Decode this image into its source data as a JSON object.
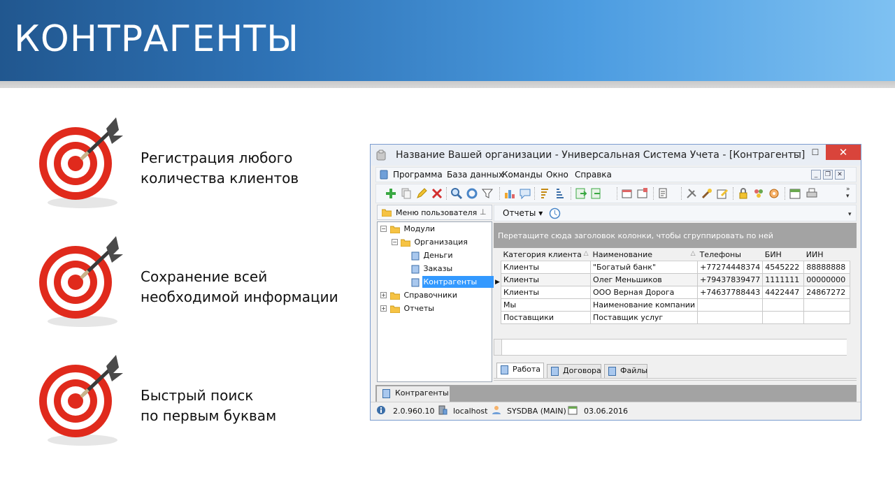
{
  "slide": {
    "title": "КОНТРАГЕНТЫ",
    "bullets": [
      {
        "line1": "Регистрация любого",
        "line2": "количества клиентов",
        "icon": "target-dart-icon"
      },
      {
        "line1": "Сохранение всей",
        "line2": "необходимой информации",
        "icon": "target-dart-icon"
      },
      {
        "line1": "Быстрый поиск",
        "line2": "по первым буквам",
        "icon": "target-dart-icon"
      }
    ],
    "colors": {
      "banner_start": "#21578f",
      "banner_end": "#7ec1f2",
      "target_red": "#e02a1c"
    }
  },
  "window": {
    "title": "Название Вашей организации - Универсальная Система Учета - [Контрагенты]",
    "controls": {
      "minimize": "—",
      "maximize": "☐",
      "close": "✕"
    },
    "menu": [
      "Программа",
      "База данных",
      "Команды",
      "Окно",
      "Справка"
    ],
    "mdi_controls": [
      "_",
      "❐",
      "✕"
    ],
    "toolbar_icons": [
      "add-icon",
      "copy-icon",
      "edit-icon",
      "delete-icon",
      "search-icon",
      "refresh-icon",
      "filter-icon",
      "chart-icon",
      "comment-icon",
      "sort-asc-icon",
      "sort-desc-icon",
      "export-icon",
      "import-icon",
      "new-window-icon",
      "new-doc-icon",
      "print-preview-icon",
      "tools-icon",
      "wand-icon",
      "edit-doc-icon",
      "lock-icon",
      "users-icon",
      "settings-icon",
      "calendar-icon",
      "printer-icon"
    ],
    "user_menu": {
      "header": "Меню пользователя",
      "tree": [
        {
          "label": "Модули",
          "level": 0,
          "expanded": true,
          "type": "folder"
        },
        {
          "label": "Организация",
          "level": 1,
          "expanded": true,
          "type": "folder"
        },
        {
          "label": "Деньги",
          "level": 2,
          "type": "doc"
        },
        {
          "label": "Заказы",
          "level": 2,
          "type": "doc"
        },
        {
          "label": "Контрагенты",
          "level": 2,
          "type": "doc",
          "selected": true
        },
        {
          "label": "Справочники",
          "level": 0,
          "expanded": false,
          "type": "folder"
        },
        {
          "label": "Отчеты",
          "level": 0,
          "expanded": false,
          "type": "folder"
        }
      ]
    },
    "reports_button": "Отчеты",
    "group_hint": "Перетащите сюда заголовок колонки, чтобы сгруппировать по ней",
    "grid": {
      "columns": [
        "Категория клиента",
        "Наименование",
        "Телефоны",
        "БИН",
        "ИИН"
      ],
      "rows": [
        [
          "Клиенты",
          "\"Богатый банк\"",
          "+77274448374",
          "4545222",
          "88888888"
        ],
        [
          "Клиенты",
          "Олег Меньшиков",
          "+79437839477",
          "1111111",
          "00000000"
        ],
        [
          "Клиенты",
          "ООО Верная Дорога",
          "+74637788443",
          "4422447",
          "24867272"
        ],
        [
          "Мы",
          "Наименование компании",
          "",
          "",
          ""
        ],
        [
          "Поставщики",
          "Поставщик услуг",
          "",
          "",
          ""
        ]
      ],
      "current_row_marker": "▶"
    },
    "tabs": [
      "Работа",
      "Договора",
      "Файлы"
    ],
    "doc_tab": "Контрагенты",
    "status": {
      "version": "2.0.960.10",
      "server": "localhost",
      "user": "SYSDBA (MAIN)",
      "date": "03.06.2016"
    }
  }
}
